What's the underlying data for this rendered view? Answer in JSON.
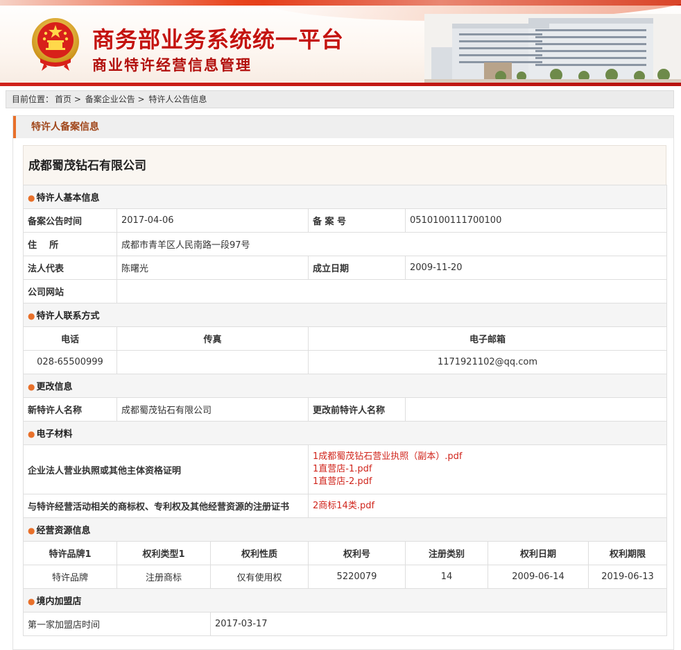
{
  "header": {
    "title": "商务部业务系统统一平台",
    "subtitle": "商业特许经营信息管理"
  },
  "breadcrumb": {
    "prefix": "目前位置：",
    "items": [
      "首页",
      "备案企业公告",
      "特许人公告信息"
    ],
    "separator": " > "
  },
  "panel": {
    "title": "特许人备案信息",
    "company_name": "成都蜀茂钻石有限公司"
  },
  "basic": {
    "section": "特许人基本信息",
    "announce_date_label": "备案公告时间",
    "announce_date": "2017-04-06",
    "record_no_label": "备 案 号",
    "record_no": "0510100111700100",
    "address_label": "住    所",
    "address": "成都市青羊区人民南路一段97号",
    "legal_rep_label": "法人代表",
    "legal_rep": "陈曙光",
    "founded_label": "成立日期",
    "founded": "2009-11-20",
    "website_label": "公司网站",
    "website": ""
  },
  "contact": {
    "section": "特许人联系方式",
    "phone_label": "电话",
    "fax_label": "传真",
    "email_label": "电子邮箱",
    "phone": "028-65500999",
    "fax": "",
    "email": "1171921102@qq.com"
  },
  "change": {
    "section": "更改信息",
    "new_name_label": "新特许人名称",
    "new_name": "成都蜀茂钻石有限公司",
    "old_name_label": "更改前特许人名称",
    "old_name": ""
  },
  "materials": {
    "section": "电子材料",
    "license_label": "企业法人营业执照或其他主体资格证明",
    "license_files": [
      "1成都蜀茂钻石营业执照（副本）.pdf",
      "1直营店-1.pdf",
      "1直营店-2.pdf"
    ],
    "trademark_label": "与特许经营活动相关的商标权、专利权及其他经营资源的注册证书",
    "trademark_files": [
      "2商标14类.pdf"
    ]
  },
  "resources": {
    "section": "经营资源信息",
    "columns": [
      "特许品牌1",
      "权利类型1",
      "权利性质",
      "权利号",
      "注册类别",
      "权利日期",
      "权利期限"
    ],
    "rows": [
      [
        "特许品牌",
        "注册商标",
        "仅有使用权",
        "5220079",
        "14",
        "2009-06-14",
        "2019-06-13"
      ]
    ]
  },
  "stores": {
    "section": "境内加盟店",
    "first_store_label": "第一家加盟店时间",
    "first_store_date": "2017-03-17"
  },
  "colors": {
    "brand_red": "#c4130f",
    "accent_orange": "#e8702a",
    "link_red": "#d0251c"
  }
}
